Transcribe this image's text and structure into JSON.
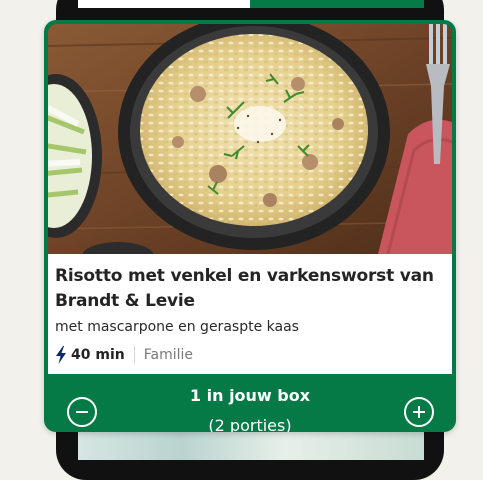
{
  "recipe": {
    "title": "Risotto met venkel en varkensworst van Brandt & Levie",
    "subtitle": "met mascarpone en geraspte kaas",
    "time": "40 min",
    "tag": "Familie",
    "image": "risotto-dish-photo"
  },
  "box": {
    "count_label": "1 in jouw box",
    "portions_label": "(2 porties)",
    "decrease_icon": "minus-circle-icon",
    "increase_icon": "plus-circle-icon"
  },
  "colors": {
    "brand_green": "#067a46",
    "card_bg": "#ffffff",
    "title_text": "#242424",
    "tag_text": "#7a7a7a",
    "page_bg": "#f2f1ec"
  },
  "icons": {
    "time": "lightning-bolt-icon"
  }
}
